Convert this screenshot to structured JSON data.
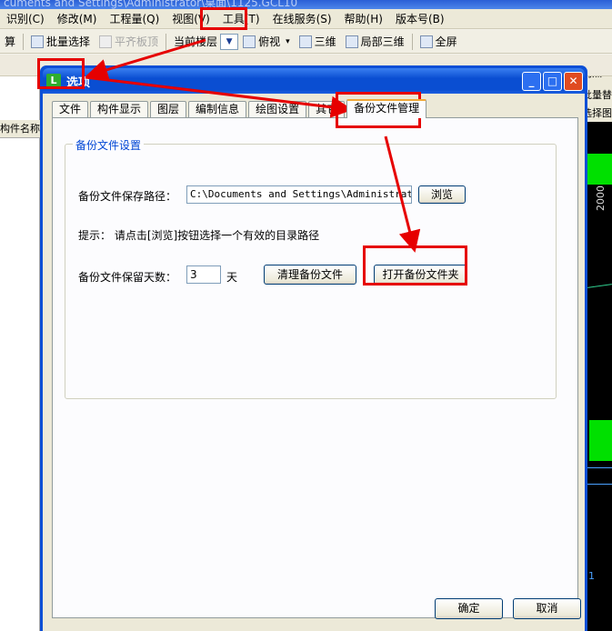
{
  "window": {
    "title_fragment": "cuments and Settings\\Administrator\\桌面\\1125.GCL10"
  },
  "menubar": [
    "识别(C)",
    "修改(M)",
    "工程量(Q)",
    "视图(V)",
    "工具(T)",
    "在线服务(S)",
    "帮助(H)",
    "版本号(B)"
  ],
  "toolbar1": {
    "edge": "算",
    "batch_select": "批量选择",
    "align_top": "平齐板顶",
    "current_floor": "当前楼层",
    "top_view": "俯视",
    "three_d": "三维",
    "local_3d": "局部三维",
    "fullscreen": "全屏"
  },
  "left_panel": {
    "header": "构件名称"
  },
  "right_panel": {
    "label1": "两点",
    "label2": "批量替",
    "label3": "选择图",
    "coord1": "2000",
    "coord2": "1"
  },
  "dialog": {
    "title": "选项",
    "tabs": [
      "文件",
      "构件显示",
      "图层",
      "编制信息",
      "绘图设置",
      "其它",
      "备份文件管理"
    ],
    "active_tab": "备份文件管理",
    "group_title": "备份文件设置",
    "path_label": "备份文件保存路径：",
    "path_value": "C:\\Documents and Settings\\Administrator\\My Documents",
    "browse_button": "浏览",
    "hint": "提示： 请点击[浏览]按钮选择一个有效的目录路径",
    "days_label": "备份文件保留天数：",
    "days_value": "3",
    "days_unit": "天",
    "clean_button": "清理备份文件",
    "open_button": "打开备份文件夹",
    "ok_button": "确定",
    "cancel_button": "取消"
  },
  "annotation_color": "#e60000"
}
